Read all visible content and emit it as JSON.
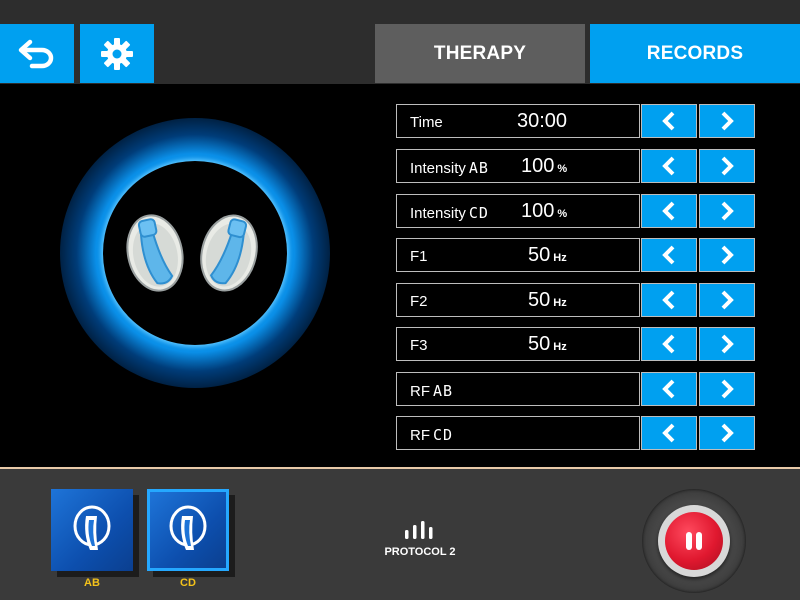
{
  "header": {
    "back_icon": "back-arrow-icon",
    "settings_icon": "gear-icon",
    "tabs": [
      {
        "label": "THERAPY",
        "active": false
      },
      {
        "label": "RECORDS",
        "active": true
      }
    ]
  },
  "parameters": [
    {
      "label": "Time",
      "sub": "",
      "value": "30:00",
      "unit": ""
    },
    {
      "label": "Intensity",
      "sub": "AB",
      "value": "100",
      "unit": "%"
    },
    {
      "label": "Intensity",
      "sub": "CD",
      "value": "100",
      "unit": "%"
    },
    {
      "label": "F1",
      "sub": "",
      "value": "50",
      "unit": "Hz"
    },
    {
      "label": "F2",
      "sub": "",
      "value": "50",
      "unit": "Hz"
    },
    {
      "label": "F3",
      "sub": "",
      "value": "50",
      "unit": "Hz"
    },
    {
      "label": "RF",
      "sub": "AB",
      "value": "",
      "unit": ""
    },
    {
      "label": "RF",
      "sub": "CD",
      "value": "",
      "unit": ""
    }
  ],
  "channels": [
    {
      "label": "AB",
      "selected": false
    },
    {
      "label": "CD",
      "selected": true
    }
  ],
  "protocol": {
    "name": "PROTOCOL 2",
    "icon": "signal-bars-icon"
  },
  "controls": {
    "pause_icon": "pause-icon"
  },
  "colors": {
    "accent": "#00a0f0",
    "inactive_tab": "#5e5e5e",
    "topbar": "#2d2d2d",
    "bottombar": "#3a3a3a",
    "channel_label": "#f4c21a",
    "pause": "#e0182f"
  }
}
